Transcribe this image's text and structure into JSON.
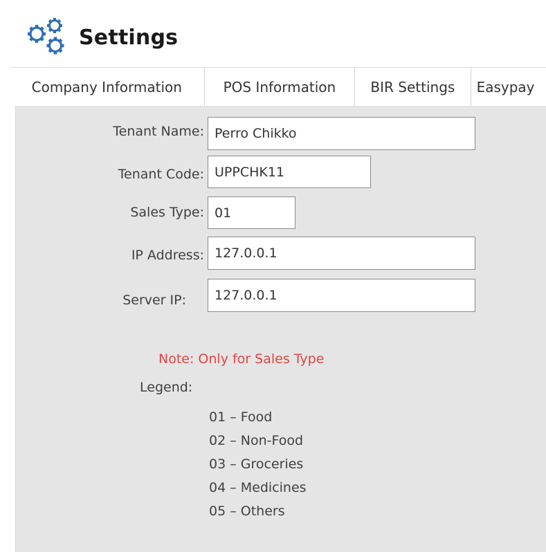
{
  "header": {
    "title": "Settings",
    "icon": "gears-icon"
  },
  "tabs": [
    {
      "label": "Company Information",
      "active": false
    },
    {
      "label": "POS Information",
      "active": true
    },
    {
      "label": "BIR Settings",
      "active": false
    },
    {
      "label": "Easypay",
      "active": false
    }
  ],
  "form": {
    "tenant_name": {
      "label": "Tenant Name:",
      "value": "Perro Chikko"
    },
    "tenant_code": {
      "label": "Tenant Code:",
      "value": "UPPCHK11"
    },
    "sales_type": {
      "label": "Sales Type:",
      "value": "01"
    },
    "ip_address": {
      "label": "IP Address:",
      "value": "127.0.0.1"
    },
    "server_ip": {
      "label": "Server IP:",
      "value": "127.0.0.1"
    }
  },
  "note": {
    "text": "Note: Only for Sales Type",
    "color": "#e24444"
  },
  "legend": {
    "title": "Legend:",
    "items": [
      "01 – Food",
      "02 – Non-Food",
      "03 – Groceries",
      "04 – Medicines",
      "05 – Others"
    ]
  },
  "colors": {
    "panel_bg": "#e5e5e5",
    "note": "#e24444"
  }
}
